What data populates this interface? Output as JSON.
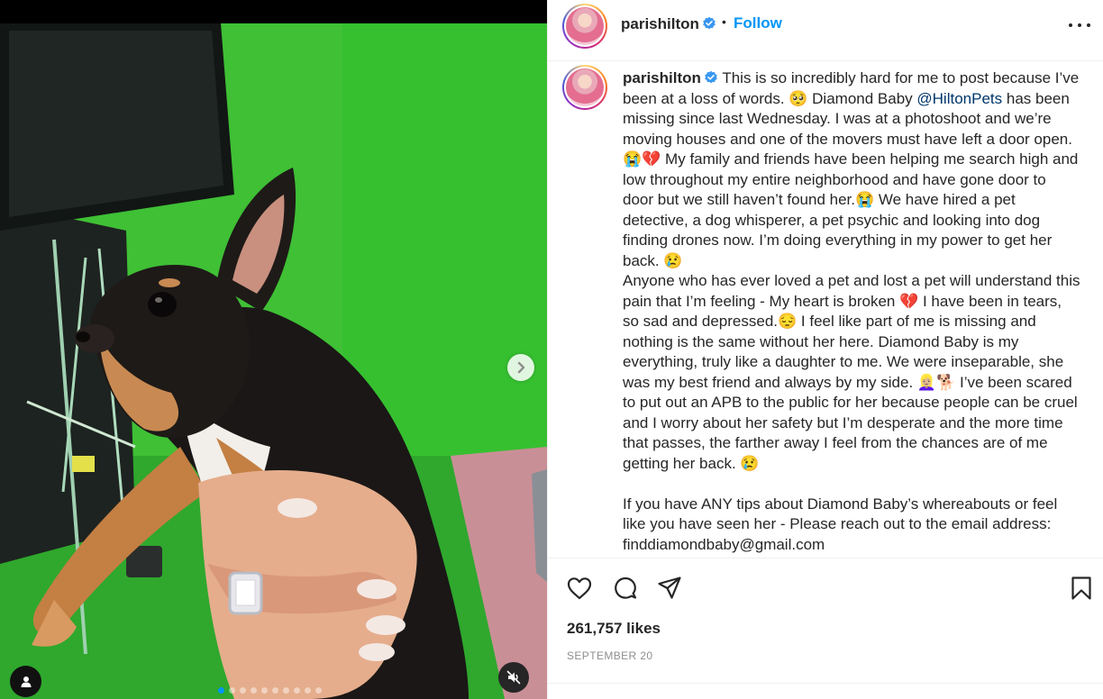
{
  "post": {
    "username": "parishilton",
    "follow_label": "Follow",
    "header_separator": "•",
    "likes": "261,757 likes",
    "date": "SEPTEMBER 20"
  },
  "caption": {
    "username": "parishilton",
    "mention": "@HiltonPets",
    "p1_before_mention": " This is so incredibly hard for me to post because I’ve been at a loss of words. 🥺 Diamond Baby ",
    "p1_after_mention": " has been missing since last Wednesday. I was at a photoshoot and we’re moving houses and one of the movers must have left a door open.😭💔 My family and friends have been helping me search high and low throughout my entire neighborhood and have gone door to door but we still haven’t found her.😭 We have hired a pet detective, a dog whisperer, a pet psychic and looking into dog finding drones now. I’m doing everything in my power to get her back. 😢",
    "p2": "Anyone who has ever loved a pet and lost a pet will understand this pain that I’m feeling - My heart is broken 💔 I have been in tears, so sad and depressed.😔 I feel like part of me is missing and nothing is the same without her here. Diamond Baby is my everything, truly like a daughter to me. We were inseparable, she was my best friend and always by my side. 👱🏼‍♀️🐕 I’ve been scared to put out an APB to the public for her because people can be cruel and I worry about her safety but I’m desperate and the more time that passes, the farther away I feel from the chances are of me getting her back. 😢",
    "p3": "If you have ANY tips about Diamond Baby’s whereabouts or feel like you have seen her - Please reach out to the email address: finddiamondbaby@gmail.com"
  },
  "media": {
    "carousel_count": 10,
    "carousel_active_index": 0,
    "icons": [
      "chevron-right-icon",
      "user-tag-icon",
      "muted-speaker-icon"
    ]
  },
  "colors": {
    "accent": "#0095f6",
    "verified": "#3897f0",
    "text": "#262626",
    "muted": "#8e8e8e",
    "greenscreen": "#3fc035"
  },
  "actions": {
    "icons": [
      "heart-icon",
      "comment-icon",
      "share-icon",
      "bookmark-icon"
    ]
  }
}
